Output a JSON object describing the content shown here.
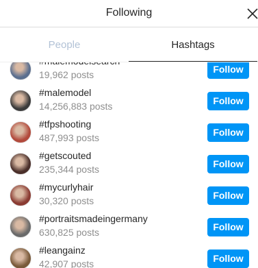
{
  "modal": {
    "title": "Following",
    "close_icon": "close-icon"
  },
  "tabs": [
    {
      "label": "People",
      "active": false
    },
    {
      "label": "Hashtags",
      "active": true
    }
  ],
  "follow_label": "Follow",
  "colors": {
    "accent": "#0095f6",
    "muted_tab": "#b2c2d6",
    "secondary_text": "#8e8e8e"
  },
  "hashtags": [
    {
      "tag": "#malemodelsearch",
      "count": "19,962 posts",
      "avatar_color": "#5b6f8f"
    },
    {
      "tag": "#malemodel",
      "count": "14,256,883 posts",
      "avatar_color": "#3b3b3b"
    },
    {
      "tag": "#tfpshooting",
      "count": "487,993 posts",
      "avatar_color": "#b24a3c"
    },
    {
      "tag": "#getscouted",
      "count": "235,344 posts",
      "avatar_color": "#4a2f2a"
    },
    {
      "tag": "#mycurlyhair",
      "count": "30,320 posts",
      "avatar_color": "#8a3b32"
    },
    {
      "tag": "#portraitsmadeingermany",
      "count": "630,825 posts",
      "avatar_color": "#6a6a6a"
    },
    {
      "tag": "#leangainz",
      "count": "42,907 posts",
      "avatar_color": "#7a5a3a"
    }
  ]
}
